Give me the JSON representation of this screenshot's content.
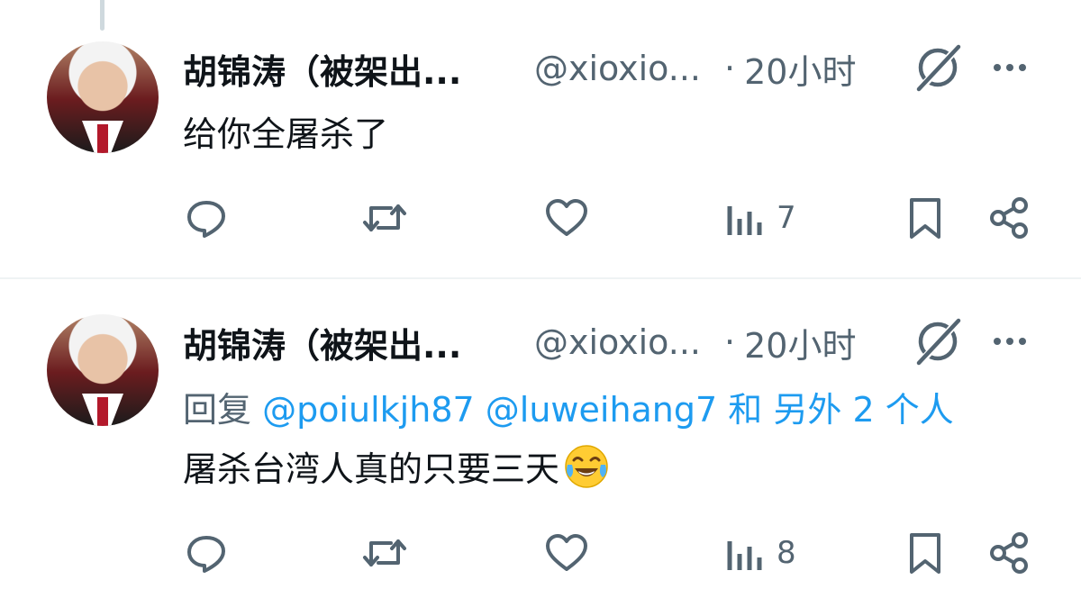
{
  "tweets": [
    {
      "author_name": "胡锦涛（被架出...",
      "handle": "@xioxio...",
      "separator": "·",
      "time": "20小时",
      "reply_prefix": "",
      "reply_mentions": [],
      "reply_suffix": "",
      "text": "给你全屠杀了",
      "emoji": "",
      "views": "7"
    },
    {
      "author_name": "胡锦涛（被架出...",
      "handle": "@xioxio...",
      "separator": "·",
      "time": "20小时",
      "reply_prefix": "回复",
      "reply_mentions": [
        "@poiulkjh87",
        "@luweihang7"
      ],
      "reply_suffix": "和 另外 2 个人",
      "text": "屠杀台湾人真的只要三天",
      "emoji": "face-with-tears-of-joy",
      "views": "8"
    }
  ],
  "icons": [
    "grok-icon",
    "more-icon",
    "reply-icon",
    "retweet-icon",
    "like-icon",
    "views-icon",
    "bookmark-icon",
    "share-icon"
  ],
  "colors": {
    "text": "#0f1419",
    "secondary": "#536471",
    "link": "#1d9bf0",
    "divider": "#eff3f4"
  }
}
